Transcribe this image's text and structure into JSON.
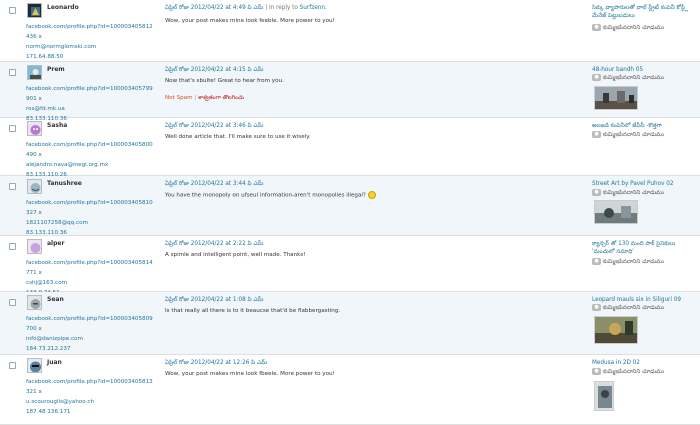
{
  "comments": [
    {
      "name": "Leonardo",
      "profile": "facebook.com/profile.php?id=100003405812",
      "profile2": "436",
      "email": "norm@normglomski.com",
      "ip": "171.64.88.50",
      "date": "ఏప్రిల్ రోజు 2012/04/22 at 4:49 పి ఎమ్",
      "reply_sep": "|",
      "reply_prefix": "In reply to",
      "reply_to": "Surfzenn.",
      "text": "Wow, your post makes mine look feeble. More power to you!",
      "post_title": "సిక్కు వ్యాపారులతో వాల్ స్ట్రీట్ కంపెనీ కోస్ట్లీ మేనేజ్ పెట్టుబడులు",
      "post_count": "కుమ్మిఇపినదానిని చూడుము"
    },
    {
      "name": "Prem",
      "profile": "facebook.com/profile.php?id=100003405799",
      "profile2": "901",
      "email": "ros@fd.mk.ua",
      "ip": "83.133.110.36",
      "date": "ఏప్రిల్ రోజు 2012/04/22 at 4:15 పి ఎమ్",
      "text": "Now that's sbulte! Great to hear from you.",
      "not_spam": "Not Spam",
      "sep": "|",
      "trash": "శాశ్వతంగా తొలగించు",
      "post_title": "48-hour bandh 05",
      "post_count": "కుమ్మిఇపినదానిని చూడుము"
    },
    {
      "name": "Sasha",
      "profile": "facebook.com/profile.php?id=100003405800",
      "profile2": "490",
      "email": "alejandro.nava@inegi.org.mx",
      "ip": "83.133.110.26",
      "date": "ఏప్రిల్ రోజు 2012/04/22 at 3:46 పి ఎమ్",
      "text": "Well done article that. I'll make sure to use it wisely.",
      "post_title": "అలజడి కంపెనీలో జేపీసీ -కొత్తగా",
      "post_count": "కుమ్మిఇపినదానిని చూడుము"
    },
    {
      "name": "Tanushree",
      "profile": "facebook.com/profile.php?id=100003405810",
      "profile2": "327",
      "email": "1821107258@qq.com",
      "ip": "83.133.110.36",
      "date": "ఏప్రిల్ రోజు 2012/04/22 at 3:44 పి ఎమ్",
      "text": "You have the monopoly on ufseul information-aren't monopolies illegal?",
      "post_title": "Street Art by Pavel Puhov 02",
      "post_count": "కుమ్మిఇపినదానిని చూడుము"
    },
    {
      "name": "alper",
      "profile": "facebook.com/profile.php?id=100003405814",
      "profile2": "771",
      "email": "cshj@163.com",
      "ip": "133.9.74.51",
      "date": "ఏప్రిల్ రోజు 2012/04/22 at 2:22 పి ఎమ్",
      "text": "A spimle and intelligent point, well made. Thanks!",
      "post_title": "క్యాన్సర్ తో 130 మంది పాక్ సైనికులు 'మంచులో సమాధి'",
      "post_count": "కుమ్మిఇపినదానిని చూడుము"
    },
    {
      "name": "Sean",
      "profile": "facebook.com/profile.php?id=100003405809",
      "profile2": "700",
      "email": "info@danizpipe.com",
      "ip": "184.73.212.237",
      "date": "ఏప్రిల్ రోజు 2012/04/22 at 1:08 పి ఎమ్",
      "text": "Is that really all there is to it beaucse that'd be flabbergasting.",
      "post_title": "Leopard mauls six in Siliguri 09",
      "post_count": "కుమ్మిఇపినదానిని చూడుము"
    },
    {
      "name": "Juan",
      "profile": "facebook.com/profile.php?id=100003405813",
      "profile2": "321",
      "email": "u.scourouglis@yahoo.ch",
      "ip": "187.48.136.171",
      "date": "ఏప్రిల్ రోజు 2012/04/22 at 12:26 పి ఎమ్",
      "text": "Wow, your post makes mine look fbeele. More power to you!",
      "post_title": "Medusa in 2D 02",
      "post_count": "కుమ్మిఇపినదానిని చూడుము"
    }
  ],
  "labels": {
    "x": "x"
  },
  "colors": {
    "link": "#21759b",
    "alt_row": "#f1f6fa",
    "spam": "#d54e21",
    "trash": "#bc0b0b"
  },
  "icons": {
    "checkbox": "checkbox-icon",
    "comment_bubble": "comment-bubble-icon",
    "smiley": "smiley-icon"
  }
}
